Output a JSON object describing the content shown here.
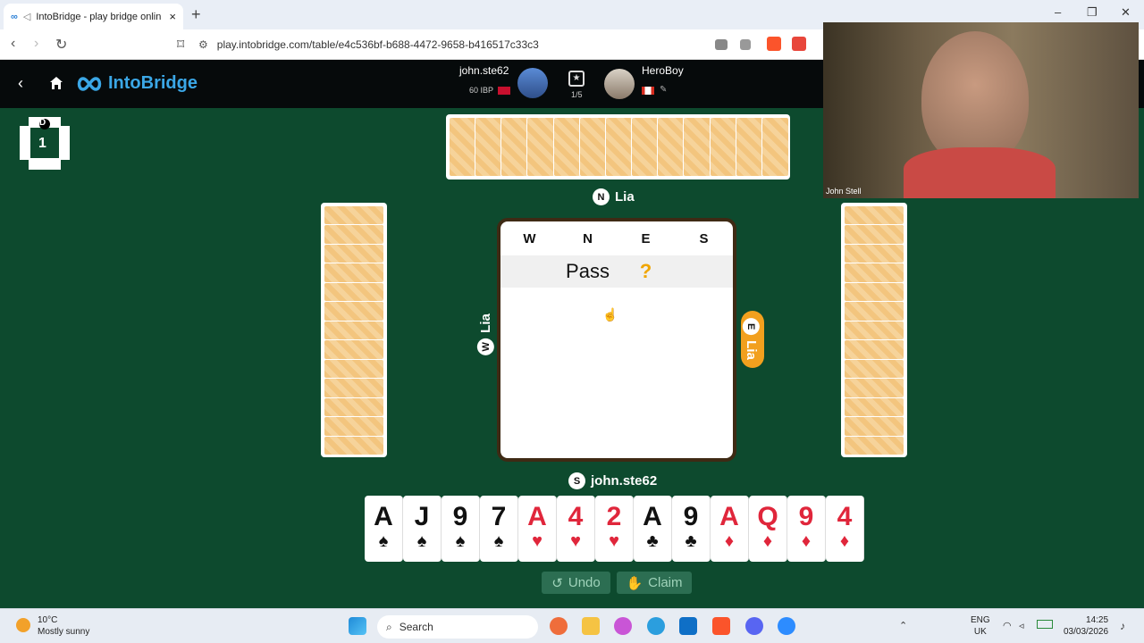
{
  "browser": {
    "tab_title": "IntoBridge - play bridge onlin",
    "url": "play.intobridge.com/table/e4c536bf-b688-4472-9658-b416517c33c3"
  },
  "app": {
    "logo_text": "IntoBridge",
    "player1": {
      "name": "john.ste62",
      "rating": "60 IBP"
    },
    "player2": {
      "name": "HeroBoy"
    },
    "round": "1/5"
  },
  "table": {
    "dealer_letter": "D",
    "board_number": "1",
    "north": {
      "seat": "N",
      "name": "Lia"
    },
    "west": {
      "seat": "W",
      "name": "Lia"
    },
    "east": {
      "seat": "E",
      "name": "Lia"
    },
    "south": {
      "seat": "S",
      "name": "john.ste62"
    },
    "bid_columns": [
      "W",
      "N",
      "E",
      "S"
    ],
    "bids": {
      "w": "",
      "n": "Pass",
      "e": "?",
      "s": ""
    }
  },
  "hand": [
    {
      "rank": "A",
      "suit": "♠",
      "color": "black"
    },
    {
      "rank": "J",
      "suit": "♠",
      "color": "black"
    },
    {
      "rank": "9",
      "suit": "♠",
      "color": "black"
    },
    {
      "rank": "7",
      "suit": "♠",
      "color": "black"
    },
    {
      "rank": "A",
      "suit": "♥",
      "color": "red"
    },
    {
      "rank": "4",
      "suit": "♥",
      "color": "red"
    },
    {
      "rank": "2",
      "suit": "♥",
      "color": "red"
    },
    {
      "rank": "A",
      "suit": "♣",
      "color": "black"
    },
    {
      "rank": "9",
      "suit": "♣",
      "color": "black"
    },
    {
      "rank": "A",
      "suit": "♦",
      "color": "red"
    },
    {
      "rank": "Q",
      "suit": "♦",
      "color": "red"
    },
    {
      "rank": "9",
      "suit": "♦",
      "color": "red"
    },
    {
      "rank": "4",
      "suit": "♦",
      "color": "red"
    }
  ],
  "buttons": {
    "undo": "Undo",
    "claim": "Claim"
  },
  "webcam": {
    "name": "John Stell"
  },
  "taskbar": {
    "temp": "10°C",
    "weather": "Mostly sunny",
    "search": "Search",
    "lang1": "ENG",
    "lang2": "UK",
    "time": "14:25",
    "date": "03/03/2026"
  }
}
